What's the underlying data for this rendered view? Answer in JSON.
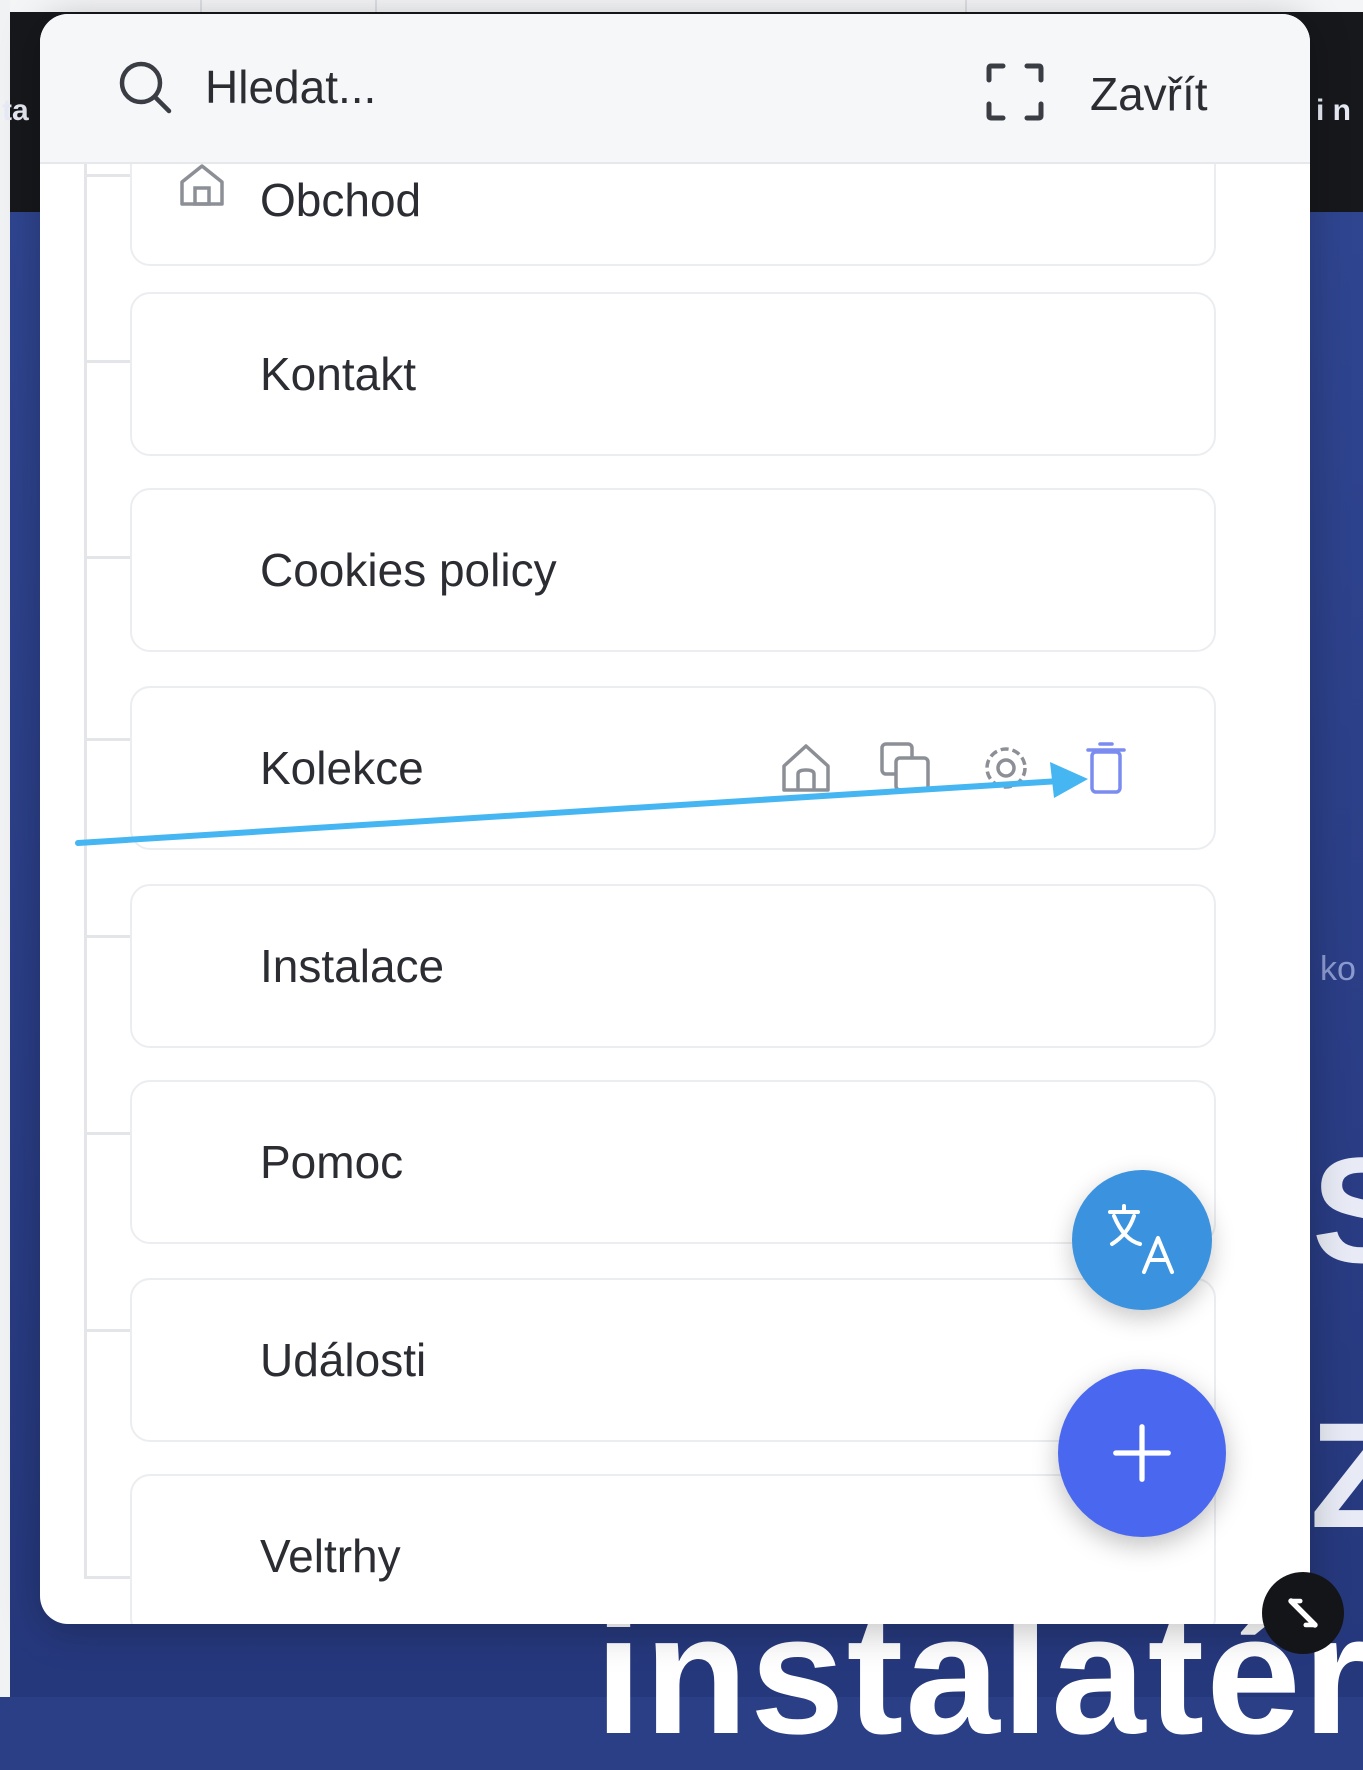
{
  "header": {
    "search_placeholder": "Hledat...",
    "close_label": "Zavřít"
  },
  "pages": [
    {
      "label": "Obchod",
      "home": true
    },
    {
      "label": "Kontakt"
    },
    {
      "label": "Cookies policy"
    },
    {
      "label": "Kolekce",
      "hovered": true
    },
    {
      "label": "Instalace"
    },
    {
      "label": "Pomoc"
    },
    {
      "label": "Události"
    },
    {
      "label": "Veltrhy"
    }
  ],
  "item_actions": [
    "home-icon",
    "duplicate-icon",
    "gear-icon",
    "trash-icon"
  ],
  "fabs": {
    "translate": "translate-icon",
    "add": "plus-icon"
  },
  "background": {
    "big_text": "instalatér",
    "side_left": "ta",
    "side_right_top": "i n",
    "side_right_mid": "ko",
    "side_right_s": "S",
    "side_right_z": "Z"
  },
  "colors": {
    "accent_blue": "#4a68ef",
    "translate_blue": "#3b93df",
    "trash_highlight": "#7b8cf0",
    "arrow": "#45b6f2",
    "hero_bg": "#2b3f86"
  }
}
